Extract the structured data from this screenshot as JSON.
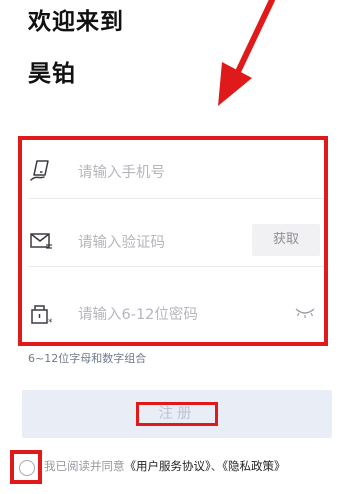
{
  "header": {
    "welcome_line1": "欢迎来到",
    "welcome_line2": "昊铂"
  },
  "form": {
    "phone": {
      "placeholder": "请输入手机号",
      "icon": "phone-icon"
    },
    "code": {
      "placeholder": "请输入验证码",
      "icon": "mail-icon",
      "fetch_label": "获取"
    },
    "password": {
      "placeholder": "请输入6-12位密码",
      "icon": "lock-icon",
      "toggle_icon": "eye-closed-icon"
    },
    "hint": "6~12位字母和数字组合"
  },
  "register": {
    "label": "注册"
  },
  "agreement": {
    "prefix": "我已阅读并同意",
    "user_agreement": "《用户服务协议》",
    "separator": "、",
    "privacy_policy": "《隐私政策》"
  },
  "colors": {
    "annotation_red": "#e01a1a",
    "placeholder_gray": "#b6b6bc",
    "register_bg": "#e9edf6",
    "hint_color": "#6f7a8c"
  }
}
